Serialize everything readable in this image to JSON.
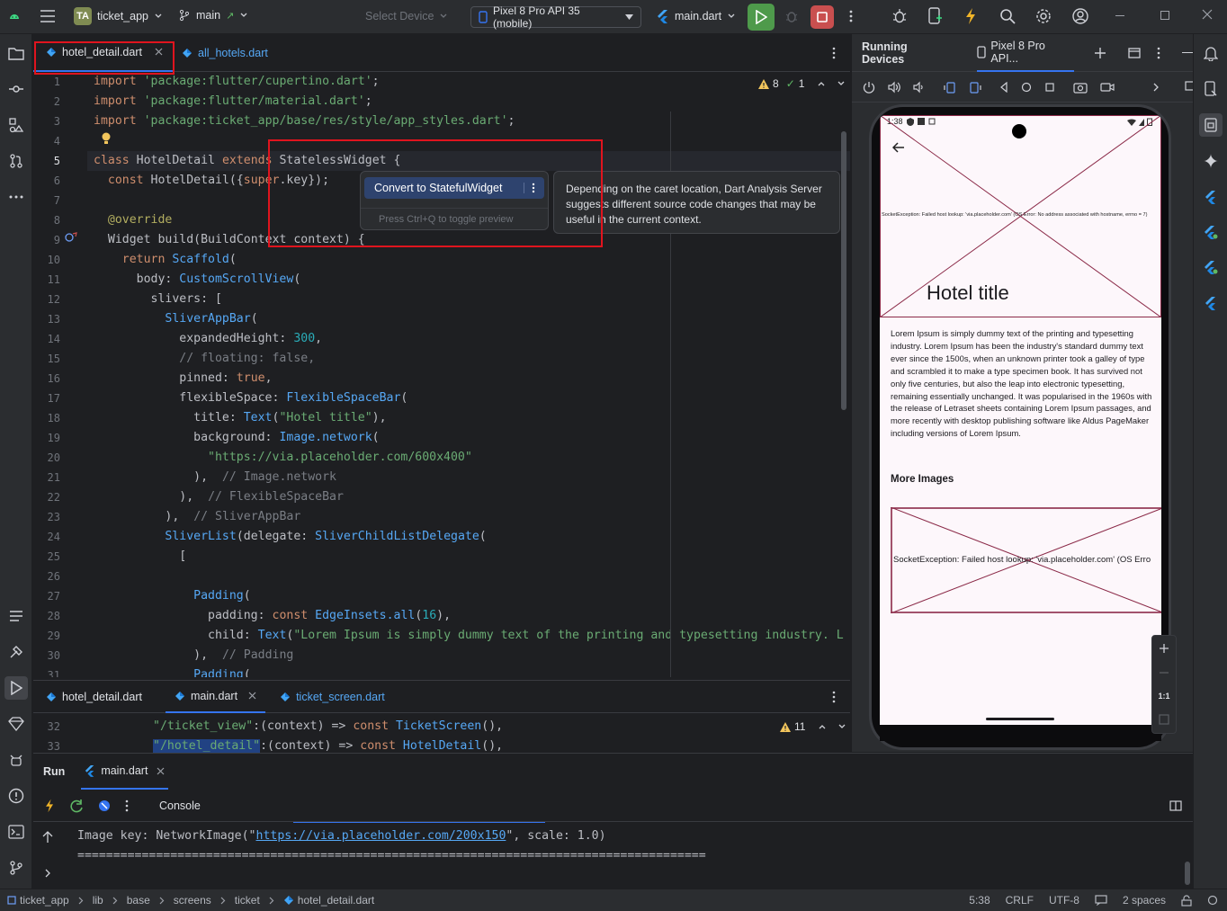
{
  "topbar": {
    "project_badge": "TA",
    "project_name": "ticket_app",
    "branch": "main",
    "select_device": "Select Device",
    "device": "Pixel 8 Pro API 35 (mobile)",
    "run_config": "main.dart"
  },
  "editor": {
    "tabs": [
      {
        "label": "hotel_detail.dart"
      },
      {
        "label": "all_hotels.dart"
      }
    ],
    "inspection": {
      "warnings": "8",
      "checks": "1"
    },
    "lines": [
      {
        "n": "1"
      },
      {
        "n": "2"
      },
      {
        "n": "3"
      },
      {
        "n": "4"
      },
      {
        "n": "5"
      },
      {
        "n": "6"
      },
      {
        "n": "7"
      },
      {
        "n": "8"
      },
      {
        "n": "9"
      },
      {
        "n": "10"
      },
      {
        "n": "11"
      },
      {
        "n": "12"
      },
      {
        "n": "13"
      },
      {
        "n": "14"
      },
      {
        "n": "15"
      },
      {
        "n": "16"
      },
      {
        "n": "17"
      },
      {
        "n": "18"
      },
      {
        "n": "19"
      },
      {
        "n": "20"
      },
      {
        "n": "21"
      },
      {
        "n": "22"
      },
      {
        "n": "23"
      },
      {
        "n": "24"
      },
      {
        "n": "25"
      },
      {
        "n": "26"
      },
      {
        "n": "27"
      },
      {
        "n": "28"
      },
      {
        "n": "29"
      },
      {
        "n": "30"
      },
      {
        "n": "31"
      }
    ],
    "code": {
      "l1_kw": "import",
      "l1_str": "'package:flutter/cupertino.dart'",
      "l1_end": ";",
      "l2_kw": "import",
      "l2_str": "'package:flutter/material.dart'",
      "l2_end": ";",
      "l3_kw": "import",
      "l3_str": "'package:ticket_app/base/res/style/app_styles.dart'",
      "l3_end": ";",
      "l5_kw1": "class",
      "l5_cls": "HotelDetail",
      "l5_kw2": "extends",
      "l5_sup": "StatelessWidget",
      "l5_end": "{",
      "l6_kw": "const",
      "l6_rest": "HotelDetail({",
      "l6_super": "super",
      "l6_end": ".key});",
      "l8": "@override",
      "l9_a": "Widget",
      "l9_b": "build(BuildContext context) {",
      "l10_kw": "return",
      "l10_fn": "Scaffold",
      "l10_end": "(",
      "l11_a": "body: ",
      "l11_fn": "CustomScrollView",
      "l11_end": "(",
      "l12": "slivers: [",
      "l13_fn": "SliverAppBar",
      "l13_end": "(",
      "l14_a": "expandedHeight: ",
      "l14_n": "300",
      "l14_end": ",",
      "l15": "// floating: false,",
      "l16_a": "pinned: ",
      "l16_k": "true",
      "l16_end": ",",
      "l17_a": "flexibleSpace: ",
      "l17_fn": "FlexibleSpaceBar",
      "l17_end": "(",
      "l18_a": "title: ",
      "l18_fn": "Text",
      "l18_b": "(",
      "l18_s": "\"Hotel title\"",
      "l18_end": "),",
      "l19_a": "background: ",
      "l19_fn": "Image.network",
      "l19_end": "(",
      "l20": "\"https://via.placeholder.com/600x400\"",
      "l21_a": "),",
      "l21_c": "// Image.network",
      "l22_a": "),",
      "l22_c": "// FlexibleSpaceBar",
      "l23_a": "),",
      "l23_c": "// SliverAppBar",
      "l24_fn": "SliverList",
      "l24_a": "(delegate: ",
      "l24_fn2": "SliverChildListDelegate",
      "l24_end": "(",
      "l25": "[",
      "l27_fn": "Padding",
      "l27_end": "(",
      "l28_a": "padding: ",
      "l28_k": "const",
      "l28_fn": "EdgeInsets.all",
      "l28_b": "(",
      "l28_n": "16",
      "l28_end": "),",
      "l29_a": "child: ",
      "l29_fn": "Text",
      "l29_b": "(",
      "l29_s": "\"Lorem Ipsum is simply dummy text of the printing and typesetting industry. L",
      "l30_a": "),",
      "l30_c": "// Padding",
      "l31_fn": "Padding",
      "l31_end": "("
    },
    "intention_button": "Convert to StatefulWidget",
    "intention_hint": "Press Ctrl+Q to toggle preview",
    "tooltip": "Depending on the caret location, Dart Analysis Server suggests different source code changes that may be useful in the current context."
  },
  "editor2": {
    "tabs": [
      {
        "label": "hotel_detail.dart"
      },
      {
        "label": "main.dart"
      },
      {
        "label": "ticket_screen.dart"
      }
    ],
    "warnings": "11",
    "lines": [
      {
        "n": "32",
        "a": "\"/ticket_view\"",
        "b": ":(context) => ",
        "k": "const",
        "fn": "TicketScreen",
        "end": "(),"
      },
      {
        "n": "33",
        "a": "\"/hotel_detail\"",
        "b": ":(context) => ",
        "k": "const",
        "fn": "HotelDetail",
        "end": "(),"
      }
    ]
  },
  "devices": {
    "title": "Running Devices",
    "device_tab": "Pixel 8 Pro API...",
    "phone": {
      "status_time": "1:38",
      "appbar_title": "Hotel title",
      "error_small": "SocketException: Failed host lookup: 'via.placeholder.com' (OS Error: No address associated with hostname, errno = 7)",
      "body": "Lorem Ipsum is simply dummy text of the printing and typesetting industry. Lorem Ipsum has been the industry's standard dummy text ever since the 1500s, when an unknown printer took a galley of type and scrambled it to make a type specimen book. It has survived not only five centuries, but also the leap into electronic typesetting, remaining essentially unchanged. It was popularised in the 1960s with the release of Letraset sheets containing Lorem Ipsum passages, and more recently with desktop publishing software like Aldus PageMaker including versions of Lorem Ipsum.",
      "more_images": "More Images",
      "error_large": "SocketException: Failed host lookup: 'via.placeholder.com' (OS Erro"
    },
    "zoom_ratio": "1:1"
  },
  "run": {
    "tab_run": "Run",
    "tab_config": "main.dart",
    "console_label": "Console",
    "log_prefix": "Image key: NetworkImage(\"",
    "log_url": "https://via.placeholder.com/200x150",
    "log_suffix": "\", scale: 1.0)",
    "log_rule": "========================================================================================"
  },
  "statusbar": {
    "crumbs": [
      "ticket_app",
      "lib",
      "base",
      "screens",
      "ticket",
      "hotel_detail.dart"
    ],
    "position": "5:38",
    "line_sep": "CRLF",
    "encoding": "UTF-8",
    "indent": "2 spaces"
  },
  "colors": {
    "highlight_red": "#e0141e",
    "accent_blue": "#3574f0",
    "run_green": "#4e9a4b"
  }
}
